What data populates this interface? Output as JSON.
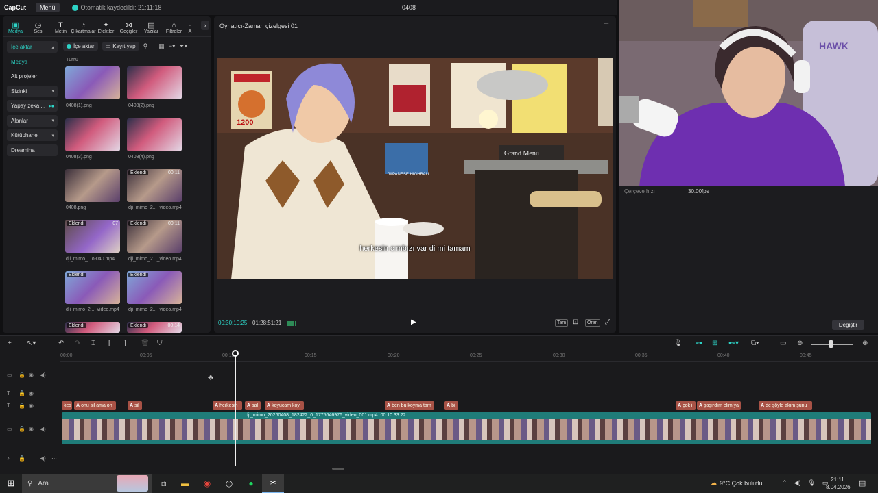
{
  "app": {
    "logo": "CapCut",
    "menu_label": "Menü",
    "autosave_text": "Otomatik kaydedildi: 21:11:18",
    "project_name": "0408"
  },
  "tabs": [
    {
      "label": "Medya",
      "icon": "media-icon",
      "glyph": "▣"
    },
    {
      "label": "Ses",
      "icon": "audio-icon",
      "glyph": "◷"
    },
    {
      "label": "Metin",
      "icon": "text-icon",
      "glyph": "T"
    },
    {
      "label": "Çıkartmalar",
      "icon": "sticker-icon",
      "glyph": "◔"
    },
    {
      "label": "Efektler",
      "icon": "effects-icon",
      "glyph": "✦"
    },
    {
      "label": "Geçişler",
      "icon": "transition-icon",
      "glyph": "⋈"
    },
    {
      "label": "Yazılar",
      "icon": "captions-icon",
      "glyph": "▤"
    },
    {
      "label": "Filtreler",
      "icon": "filter-icon",
      "glyph": "⌂"
    },
    {
      "label": "A",
      "icon": "adjust-icon",
      "glyph": "·"
    }
  ],
  "sidebar": {
    "items": [
      {
        "label": "İçe aktar",
        "chev": "▴"
      },
      {
        "label": "Medya",
        "chev": ""
      },
      {
        "label": "Alt projeler",
        "chev": ""
      },
      {
        "label": "Sizinki",
        "chev": "▾"
      },
      {
        "label": "Yapay zeka ...",
        "chev": ""
      },
      {
        "label": "Alanlar",
        "chev": "▾"
      },
      {
        "label": "Kütüphane",
        "chev": "▾"
      },
      {
        "label": "Dreamina",
        "chev": ""
      }
    ]
  },
  "media_toolbar": {
    "import_label": "İçe aktar",
    "record_label": "Kayıt yap",
    "all_label": "Tümü"
  },
  "media_items": [
    {
      "name": "0408(1).png",
      "badge": "",
      "duration": ""
    },
    {
      "name": "0408(2).png",
      "badge": "",
      "duration": ""
    },
    {
      "name": "0408(3).png",
      "badge": "",
      "duration": ""
    },
    {
      "name": "0408(4).png",
      "badge": "",
      "duration": ""
    },
    {
      "name": "0408.png",
      "badge": "",
      "duration": ""
    },
    {
      "name": "dji_mimo_2..._video.mp4",
      "badge": "Eklendi",
      "duration": "00:11"
    },
    {
      "name": "dji_mimo_...o-040.mp4",
      "badge": "Eklendi",
      "duration": "07"
    },
    {
      "name": "dji_mimo_2..._video.mp4",
      "badge": "Eklendi",
      "duration": "00:11"
    },
    {
      "name": "dji_mimo_2..._video.mp4",
      "badge": "Eklendi",
      "duration": ""
    },
    {
      "name": "dji_mimo_2..._video.mp4",
      "badge": "Eklendi",
      "duration": ""
    },
    {
      "name": "",
      "badge": "Eklendi",
      "duration": ""
    },
    {
      "name": "",
      "badge": "Eklendi",
      "duration": "00:14"
    }
  ],
  "player": {
    "title": "Oynatıcı-Zaman çizelgesi 01",
    "subtitle": "herkesin cımbızı var di mi tamam",
    "current_time": "00:30:10:25",
    "total_time": "01:28:51:21",
    "controls": {
      "full": "Tam",
      "ratio": "Oran"
    },
    "video_scene_labels": {
      "grand_menu": "Grand Menu",
      "price": "1200",
      "highball": "JAPANESE HIGHBALL"
    }
  },
  "details": {
    "frame_rate_label": "Çerçeve hızı",
    "frame_rate_value": "30.00fps",
    "change_button": "Değiştir"
  },
  "webcam": {
    "chair_text": "HAWK"
  },
  "timeline": {
    "ruler": [
      "00:00",
      "00:05",
      "00:10",
      "00:15",
      "00:20",
      "00:25",
      "00:30",
      "00:35",
      "00:40",
      "00:45"
    ],
    "video_clip_name": "dji_mimo_20260408_182422_0_1775646976_video_001.mp4",
    "video_clip_duration": "00:10:33:22",
    "zoom_level": 0.47,
    "subtitle_clips": [
      {
        "text": "kes"
      },
      {
        "text": "onu sil ama on"
      },
      {
        "text": "sil"
      },
      {
        "text": "herkesin"
      },
      {
        "text": "sal"
      },
      {
        "text": "koyucam koy"
      },
      {
        "text": "ben bu koyma tam"
      },
      {
        "text": "bi"
      },
      {
        "text": "çok i"
      },
      {
        "text": "şaşırdım elim ya"
      },
      {
        "text": "de şöyle akım şunu"
      }
    ]
  },
  "taskbar": {
    "search_label": "Ara",
    "weather": "9°C  Çok bulutlu",
    "time": "21:11",
    "date": "8.04.2026"
  },
  "colors": {
    "accent": "#2dd3c6",
    "subtitle_clip": "#a85246",
    "video_track": "#1f7c79"
  }
}
